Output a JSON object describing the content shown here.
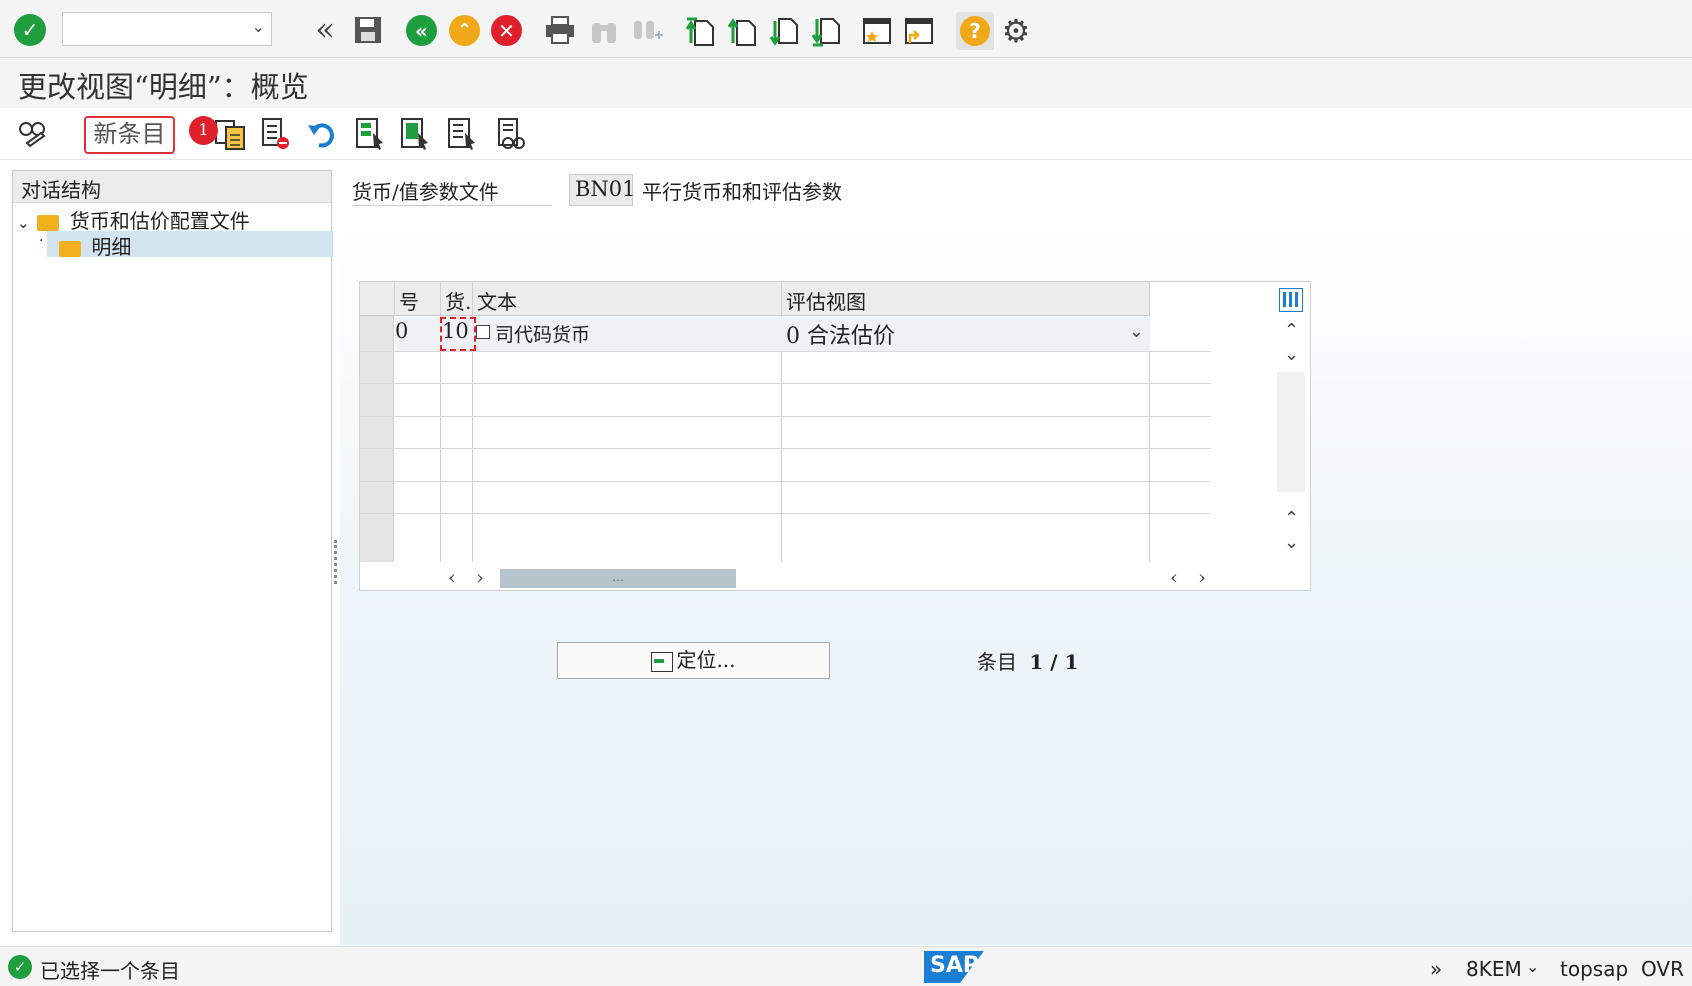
{
  "toolbar": {
    "command_placeholder": "",
    "icons": [
      "check-icon",
      "back-double-icon",
      "save-icon",
      "back-icon",
      "exit-icon",
      "cancel-icon",
      "print-icon",
      "find-icon",
      "find-next-icon",
      "first-page-icon",
      "prev-page-icon",
      "next-page-icon",
      "last-page-icon",
      "new-session-icon",
      "shortcut-icon",
      "help-icon",
      "settings-icon"
    ]
  },
  "title": "更改视图“明细”：概览",
  "app_toolbar": {
    "new_entry": "新条目",
    "badge": "1"
  },
  "tree": {
    "header": "对话结构",
    "items": [
      {
        "label": "货币和估价配置文件"
      },
      {
        "label": "明细"
      }
    ]
  },
  "param": {
    "label": "货币/值参数文件",
    "value": "BN01",
    "description": "平行货币和和评估参数"
  },
  "table": {
    "headers": [
      "号",
      "货.",
      "文本",
      "评估视图"
    ],
    "rows": [
      {
        "num": "0",
        "cur": "10",
        "text": "司代码货币",
        "view": "0  合法估价"
      }
    ],
    "scroll_thumb": "…"
  },
  "position_button": "定位...",
  "entries": {
    "label": "条目",
    "value": "1 / 1"
  },
  "status": {
    "message": "已选择一个条目",
    "logo": "SAP",
    "arrows": "»",
    "system": "8KEM",
    "host": "topsap",
    "mode": "OVR"
  },
  "colors": {
    "green": "#1e9e3c",
    "orange": "#f0a818",
    "red": "#e0202a",
    "blue": "#1a7fd4"
  }
}
